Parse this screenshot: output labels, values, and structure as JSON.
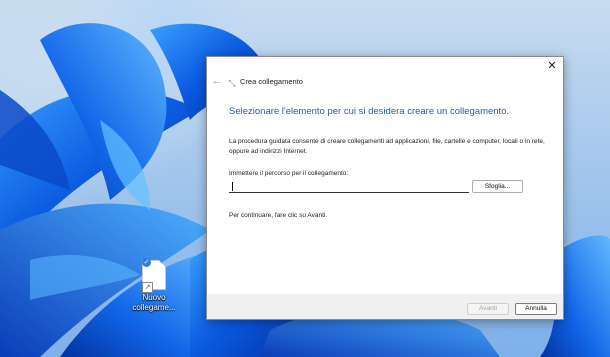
{
  "desktop": {
    "wallpaper": "Windows 11 blue bloom",
    "icon": {
      "label_line1": "Nuovo",
      "label_line2": "collegame..."
    }
  },
  "dialog": {
    "title": "Crea collegamento",
    "heading": "Selezionare l'elemento per cui si desidera creare un collegamento.",
    "description": "La procedura guidata consente di creare collegamenti ad applicazioni, file, cartelle e computer, locali o in rete, oppure ad indirizzi Internet.",
    "path_label": "Immettere il percorso per il collegamento:",
    "path_value": "",
    "browse_label": "Sfoglia...",
    "continue_text": "Per continuare, fare clic su Avanti.",
    "next_label": "Avanti",
    "cancel_label": "Annulla",
    "close_glyph": "✕",
    "back_glyph": "←"
  },
  "colors": {
    "heading": "#1d5eab",
    "wallpaper_blue": "#0a52d8"
  }
}
